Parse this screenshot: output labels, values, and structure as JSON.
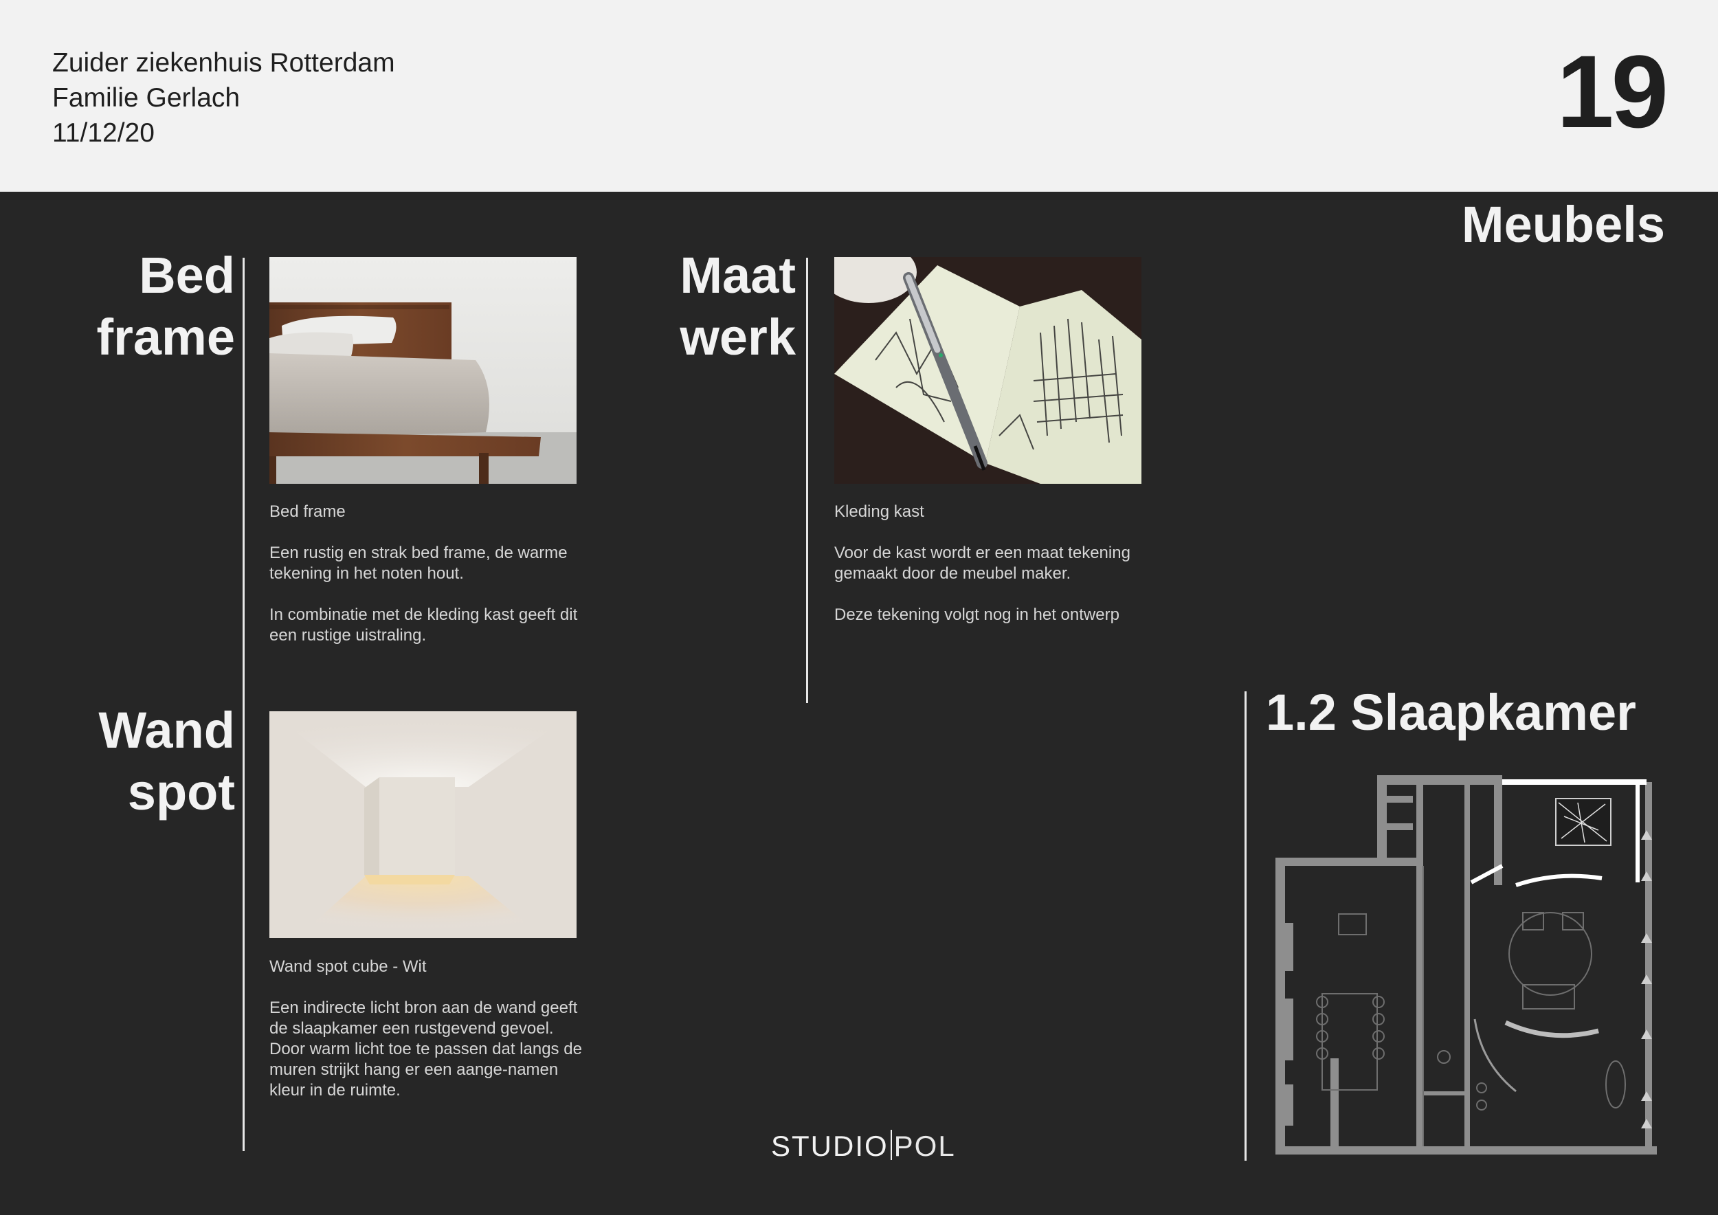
{
  "header": {
    "line1": "Zuider ziekenhuis Rotterdam",
    "line2": "Familie Gerlach",
    "date": "11/12/20",
    "page_number": "19"
  },
  "section_title": "Meubels",
  "items": [
    {
      "heading_line1": "Bed",
      "heading_line2": "frame",
      "caption_title": "Bed frame",
      "caption_p1": "Een rustig en strak bed frame, de warme tekening in het noten hout.",
      "caption_p2": "In combinatie met de kleding kast geeft dit een rustige uistraling."
    },
    {
      "heading_line1": "Maat",
      "heading_line2": "werk",
      "caption_title": "Kleding kast",
      "caption_p1": "Voor de kast wordt er een maat tekening gemaakt door de meubel maker.",
      "caption_p2": "Deze tekening volgt nog in het ontwerp"
    },
    {
      "heading_line1": "Wand",
      "heading_line2": "spot",
      "caption_title": "Wand spot cube - Wit",
      "caption_p1": "Een indirecte licht bron aan de wand geeft de slaapkamer een rustgevend gevoel. Door warm licht toe te passen dat langs de muren strijkt hang er een aange-namen kleur in de ruimte."
    }
  ],
  "room_title": "1.2 Slaapkamer",
  "brand": {
    "part1": "STUDIO",
    "part2": "POL"
  },
  "colors": {
    "background": "#262626",
    "header_bg": "#f2f2f2",
    "text_light": "#f2f2f2",
    "text_dark": "#1f1f1f"
  }
}
